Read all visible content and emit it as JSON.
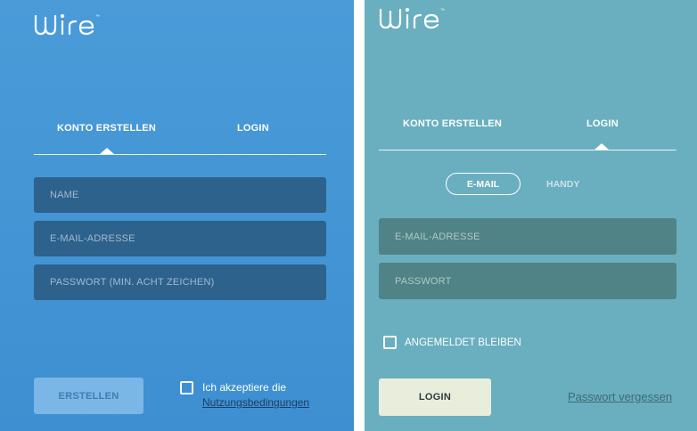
{
  "left_panel": {
    "logo_text": "wire",
    "logo_tm": "™",
    "tabs": [
      {
        "label": "KONTO ERSTELLEN",
        "active": true
      },
      {
        "label": "LOGIN",
        "active": false
      }
    ],
    "fields": {
      "name_placeholder": "NAME",
      "email_placeholder": "E-MAIL-ADRESSE",
      "password_placeholder": "PASSWORT (MIN. ACHT ZEICHEN)"
    },
    "submit_label": "ERSTELLEN",
    "terms_text": "Ich akzeptiere die",
    "terms_link": "Nutzungsbedingungen",
    "terms_checked": false
  },
  "right_panel": {
    "logo_text": "wire",
    "logo_tm": "™",
    "tabs": [
      {
        "label": "KONTO ERSTELLEN",
        "active": false
      },
      {
        "label": "LOGIN",
        "active": true
      }
    ],
    "method_toggle": [
      {
        "label": "E-MAIL",
        "selected": true
      },
      {
        "label": "HANDY",
        "selected": false
      }
    ],
    "fields": {
      "email_placeholder": "E-MAIL-ADRESSE",
      "password_placeholder": "PASSWORT"
    },
    "stay_logged_in_label": "ANGEMELDET BLEIBEN",
    "stay_logged_in_checked": false,
    "submit_label": "LOGIN",
    "forgot_password_link": "Passwort vergessen"
  },
  "colors": {
    "left_background": "#4a9bd8",
    "right_background": "#6aafbf",
    "left_field": "#2d628c",
    "right_field": "#4f8385",
    "login_button": "#e9eddc"
  }
}
